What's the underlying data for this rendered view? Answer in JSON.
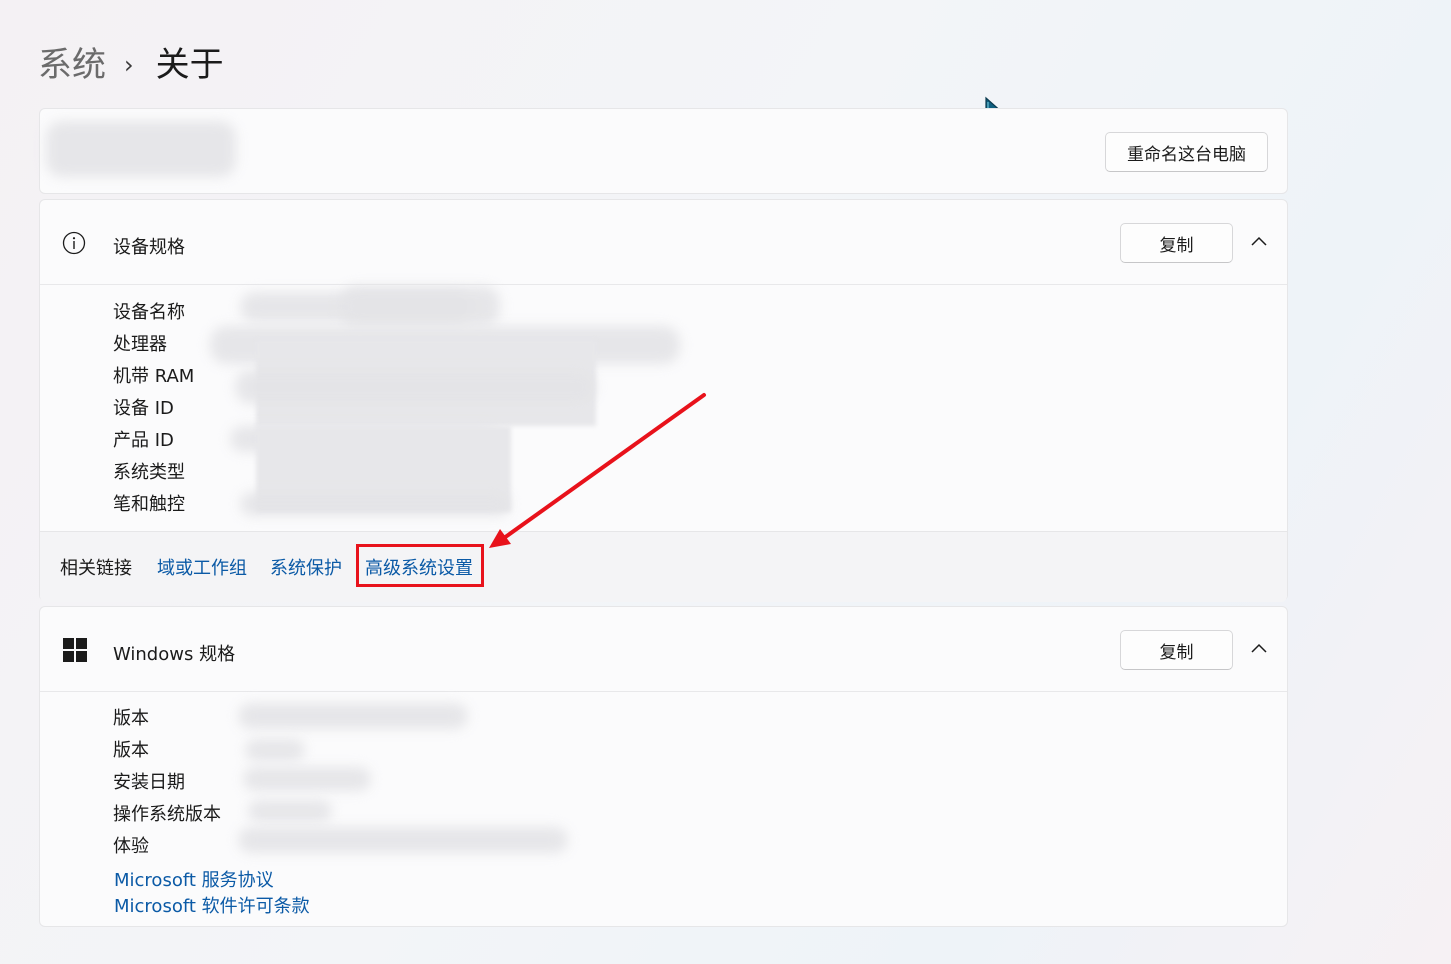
{
  "breadcrumb": {
    "parent": "系统",
    "separator": "›",
    "current": "关于"
  },
  "device_header": {
    "rename_button": "重命名这台电脑"
  },
  "device_specs": {
    "title": "设备规格",
    "copy_button": "复制",
    "labels": [
      "设备名称",
      "处理器",
      "机带 RAM",
      "设备 ID",
      "产品 ID",
      "系统类型",
      "笔和触控"
    ]
  },
  "related_links": {
    "label": "相关链接",
    "links": [
      "域或工作组",
      "系统保护",
      "高级系统设置"
    ]
  },
  "windows_specs": {
    "title": "Windows 规格",
    "copy_button": "复制",
    "labels": [
      "版本",
      "版本",
      "安装日期",
      "操作系统版本",
      "体验"
    ],
    "links": [
      "Microsoft 服务协议",
      "Microsoft 软件许可条款"
    ]
  },
  "annotation": {
    "highlight_color": "#e8121b",
    "link_color": "#0b5aa6"
  },
  "icons": [
    "info-icon",
    "chevron-up-icon",
    "windows-logo-icon",
    "mouse-cursor-icon"
  ]
}
